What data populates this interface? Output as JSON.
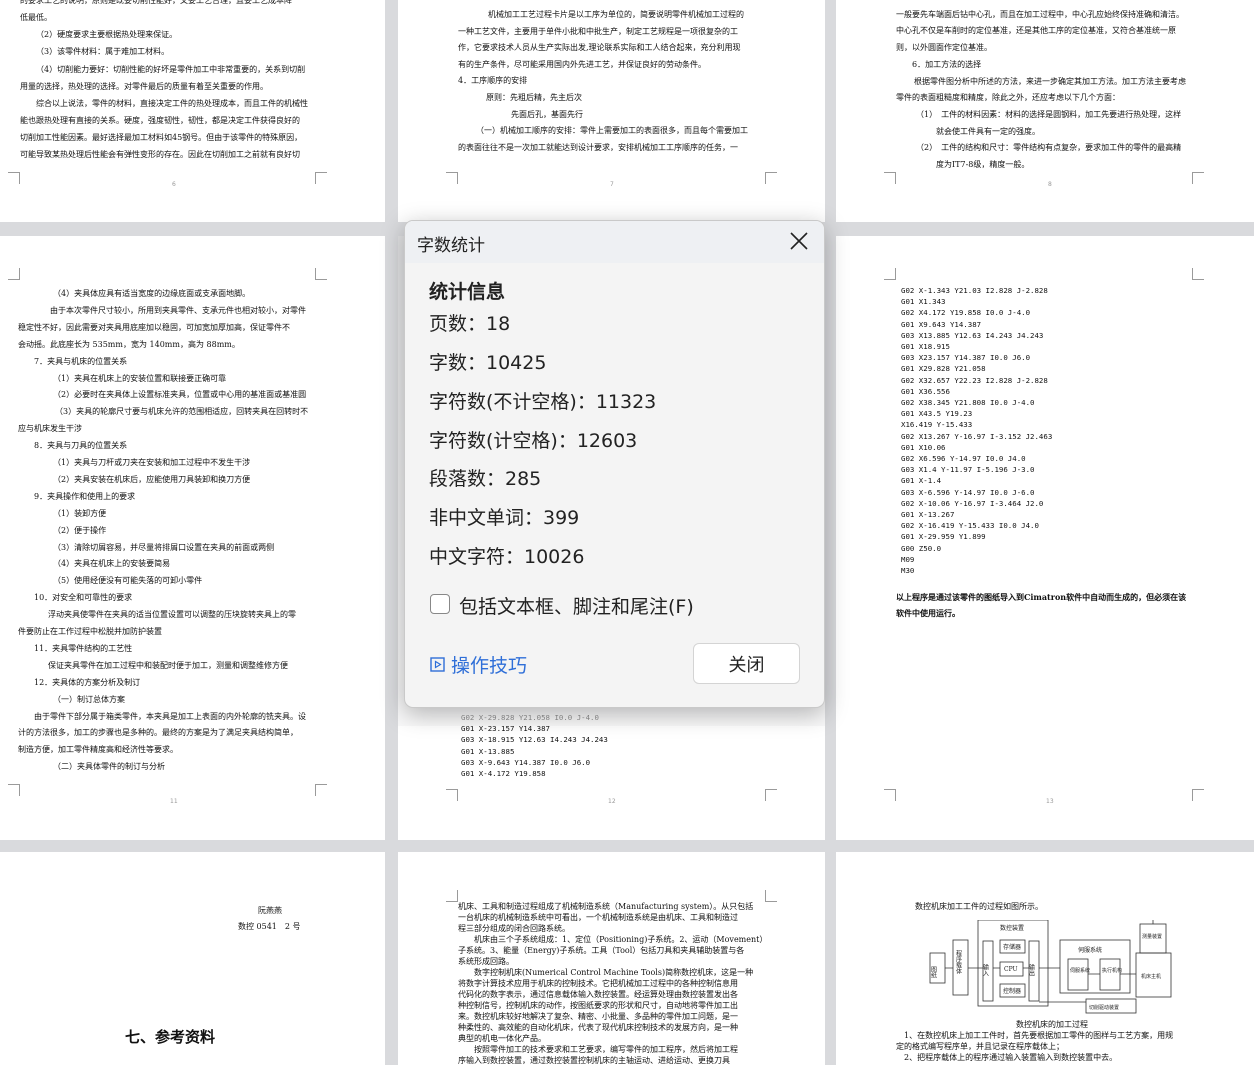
{
  "dialog": {
    "title": "字数统计",
    "section": "统计信息",
    "stats": [
      "页数：18",
      "字数：10425",
      "字符数(不计空格)：11323",
      "字符数(计空格)：12603",
      "段落数：285",
      "非中文单词：399",
      "中文字符：10026"
    ],
    "checkbox_label": "包括文本框、脚注和尾注(F)",
    "checkbox_checked": false,
    "tips_label": "操作技巧",
    "close_label": "关闭",
    "link_color": "#2f6fd8"
  },
  "pages": {
    "p6": {
      "number": "6",
      "lines": [
        "的要求工艺的说明，原则是既要切削性能好，又要工艺合理，且要工艺成本降",
        "低最低。",
        "（2）硬度要求主要根据热处理来保证。",
        "（3）该零件材料：属于难加工材料。",
        "（4）切削能力要好：切削性能的好坏是零件加工中非常重要的，关系到切削",
        "用量的选择，热处理的选择。对零件最后的质量有着至关重要的作用。",
        "综合以上说法，零件的材料，直接决定工件的热处理成本，而且工件的机械性",
        "能也跟热处理有直接的关系。硬度，强度韧性，韧性，都是决定工件获得良好的",
        "切削加工性能因素。最好选择最加工材料如45钢号。但由于该零件的特殊原因，",
        "可能导致某热处理后性能会有弹性变形的存在。因此在切削加工之前就有良好切"
      ]
    },
    "p7": {
      "number": "7",
      "lines": [
        "机械加工工艺过程卡片是以工序为单位的，简要说明零件机械加工过程的",
        "一种工艺文件，主要用于单件小批和中批生产，制定工艺规程是一项很复杂的工",
        "作，它要求技术人员从生产实际出发,理论联系实际和工人结合起来，充分利用现",
        "有的生产条件，尽可能采用国内外先进工艺，并保证良好的劳动条件。",
        "4．工序顺序的安排",
        "原则：先粗后精，先主后次",
        "先面后孔，基面先行",
        "（一）机械加工顺序的安排：零件上需要加工的表面很多，而且每个需要加工",
        "的表面往往不是一次加工就能达到设计要求，安排机械加工工序顺序的任务，一"
      ]
    },
    "p8": {
      "number": "8",
      "lines": [
        "一般要先车端面后钻中心孔，而且在加工过程中，中心孔应始终保持准确和清洁。",
        "中心孔不仅是车削时的定位基准，还是其他工序的定位基准，又符合基准统一原",
        "则，以外圆面作定位基准。",
        "6．加工方法的选择",
        "根据零件图分析中所述的方法，来进一步确定其加工方法。加工方法主要考虑",
        "零件的表面粗糙度和精度，除此之外，还应考虑以下几个方面：",
        "（1）　工件的材料因素：材料的选择是圆钢料，加工先要进行热处理，这样",
        "就会使工件具有一定的强度。",
        "（2）　工件的结构和尺寸：零件结构有点复杂，要求加工件的零件的最高精",
        "度为IT7-8级，精度一般。"
      ]
    },
    "p11": {
      "number": "11",
      "lines": [
        "（4）夹具体应具有适当宽度的边缘底面或支承面地脚。",
        "由于本次零件尺寸较小，所用到夹具零件、支承元件也相对较小，对零件",
        "稳定性不好，因此需要对夹具用底座加以稳固，可加宽加厚加高，保证零件不",
        "会动摇。此底座长为 535mm，宽为 140mm，高为 88mm。",
        "7．夹具与机床的位置关系",
        "（1）夹具在机床上的安装位置和联接要正确可靠",
        "（2）必要时在夹具体上设置标准夹具，位置或中心用的基准面或基准圆",
        "（3）夹具的轮廓尺寸要与机床允许的范围相适应，回转夹具在回转时不",
        "应与机床发生干涉",
        "8．夹具与刀具的位置关系",
        "（1）夹具与刀杆或刀夹在安装和加工过程中不发生干涉",
        "（2）夹具安装在机床后，应能使用刀具装卸和换刀方便",
        "9．夹具操作和使用上的要求",
        "（1）装卸方便",
        "（2）便于操作",
        "（3）清除切屑容易，并尽量将排屑口设置在夹具的前面或两侧",
        "（4）夹具在机床上的安装要简易",
        "（5）使用经便没有可能失落的可卸小零件",
        "10．对安全和可靠性的要求",
        "浮动夹具使零件在夹具的适当位置设置可以调整的压块旋转夹具上的零",
        "件要防止在工作过程中松脱并加防护装置",
        "11．夹具零件结构的工艺性",
        "保证夹具零件在加工过程中和装配时便于加工，测量和调整维修方便",
        "12．夹具体的方案分析及制订",
        "（一）制订总体方案",
        "由于零件下部分属于箱类零件，本夹具是加工上表面的内外轮廓的铣夹具。设",
        "计的方法很多，加工的步骤也是多种的。最终的方案是为了满足夹具结构简单，",
        "制造方便，加工零件精度高和经济性等要求。",
        "（二）夹具体零件的制订与分析"
      ]
    },
    "p12": {
      "number": "12",
      "lines": [
        "G02 X-29.828 Y21.058 I0.0 J-4.0",
        "G01 X-23.157 Y14.387",
        "G03 X-18.915 Y12.63 I4.243 J4.243",
        "G01 X-13.885",
        "G03 X-9.643 Y14.387 I0.0 J6.0",
        "G01 X-4.172 Y19.858"
      ]
    },
    "p13": {
      "number": "13",
      "lines": [
        "G02 X-1.343 Y21.03 I2.828 J-2.828",
        "G01 X1.343",
        "G02 X4.172 Y19.858 I0.0 J-4.0",
        "G01 X9.643 Y14.387",
        "G03 X13.885 Y12.63 I4.243 J4.243",
        "G01 X18.915",
        "G03 X23.157 Y14.387 I0.0 J6.0",
        "G01 X29.828 Y21.058",
        "G02 X32.657 Y22.23 I2.828 J-2.828",
        "G01 X36.556",
        "G02 X38.345 Y21.808 I0.0 J-4.0",
        "G01 X43.5 Y19.23",
        "X16.419 Y-15.433",
        "G02 X13.267 Y-16.97 I-3.152 J2.463",
        "G01 X10.06",
        "G02 X6.596 Y-14.97 I0.0 J4.0",
        "G03 X1.4 Y-11.97 I-5.196 J-3.0",
        "G01 X-1.4",
        "G03 X-6.596 Y-14.97 I0.0 J-6.0",
        "G02 X-10.06 Y-16.97 I-3.464 J2.0",
        "G01 X-13.267",
        "G02 X-16.419 Y-15.433 I0.0 J4.0",
        "G01 X-29.959 Y1.899",
        "G00 Z50.0",
        "M09",
        "M30"
      ],
      "note": [
        "以上程序是通过该零件的图纸导入到Cimatron软件中自动而生成的，但必须在该",
        "软件中使用运行。"
      ]
    },
    "cover": {
      "name": "阮燕燕",
      "class_info": "数控 0541　2 号",
      "heading": "七、参考资料"
    },
    "intro": {
      "lines": [
        "机床、工具和制造过程组成了机械制造系统（Manufacturing system）。从只包括",
        "一台机床的机械制造系统中可看出，一个机械制造系统是由机床、工具和制造过",
        "程三部分组成的闭合回路系统。",
        "　　机床由三个子系统组成：1、定位（Positioning)子系统。2、运动（Movement）",
        "子系统。3、能量（Energy)子系统。工具（Tool）包括刀具和夹具辅助装置与各",
        "系统形成回路。",
        "　　数字控制机床(Numerical Control Machine Tools)简称数控机床，这是一种",
        "将数字计算技术应用于机床的控制技术。它把机械加工过程中的各种控制信息用",
        "代码化的数字表示，通过信息载体输入数控装置。经运算处理由数控装置发出各",
        "种控制信号，控制机床的动作，按图纸要求的形状和尺寸，自动地将零件加工出",
        "来。数控机床较好地解决了复杂、精密、小批量、多品种的零件加工问题，是一",
        "种柔性的、高效能的自动化机床，代表了现代机床控制技术的发展方向，是一种",
        "典型的机电一体化产品。",
        "　　按照零件加工的技术要求和工艺要求，编写零件的加工程序，然后将加工程",
        "序输入到数控装置，通过数控装置控制机床的主轴运动、进给运动、更换刀具"
      ]
    },
    "process": {
      "intro": "数控机床加工工件的过程如图所示。",
      "caption": "数控机床的加工过程",
      "lines": [
        "　1、在数控机床上加工工件时，首先要根据加工零件的图样与工艺方案，用规",
        "定的格式编写程序单，并且记录在程序载体上；",
        "　2、把程序载体上的程序通过输入装置输入到数控装置中去。"
      ],
      "diagram": {
        "drawing": "图纸",
        "carrier": "程序载体",
        "cnc": "数控装置",
        "input": "输入",
        "memory": "存储器",
        "cpu": "CPU",
        "controller": "控制器",
        "output": "输出",
        "servo_system": "伺服系统",
        "servo": "伺服系统",
        "actuator": "执行机构",
        "measure": "测量装置",
        "machine": "机床主机",
        "cutting": "切削驱动装置"
      }
    }
  }
}
